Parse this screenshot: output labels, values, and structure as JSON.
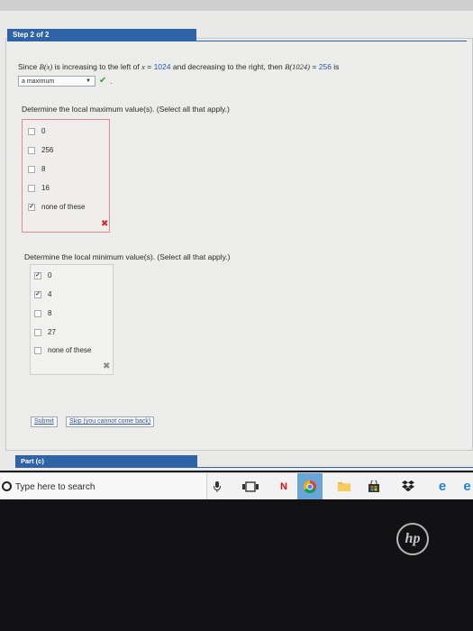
{
  "step": {
    "label": "Step 2 of 2"
  },
  "statement": {
    "since": "Since",
    "func": "B(x)",
    "middle": "is increasing to the left of",
    "xvar": "x",
    "eq": "=",
    "xval": "1024",
    "after": "and decreasing to the right, then",
    "func_at": "B(1024)",
    "eq2": "=",
    "value": "256",
    "is": "is",
    "period": "."
  },
  "dropdown": {
    "selected": "a maximum",
    "status_icon": "green-check"
  },
  "question_max": {
    "prompt": "Determine the local maximum value(s). (Select all that apply.)",
    "options": [
      {
        "label": "0",
        "checked": false
      },
      {
        "label": "256",
        "checked": false
      },
      {
        "label": "8",
        "checked": false
      },
      {
        "label": "16",
        "checked": false
      },
      {
        "label": "none of these",
        "checked": true
      }
    ],
    "result_icon": "red-x",
    "check_symbol": "✔",
    "x_symbol": "✖"
  },
  "question_min": {
    "prompt": "Determine the local minimum value(s). (Select all that apply.)",
    "options": [
      {
        "label": "0",
        "checked": true
      },
      {
        "label": "4",
        "checked": true
      },
      {
        "label": "8",
        "checked": false
      },
      {
        "label": "27",
        "checked": false
      },
      {
        "label": "none of these",
        "checked": false
      }
    ],
    "result_icon": "gray-x",
    "x_symbol": "✖"
  },
  "buttons": {
    "submit": "Submit",
    "skip": "Skip (you cannot come back)"
  },
  "part": {
    "label": "Part (c)"
  },
  "taskbar": {
    "search_placeholder": "Type here to search",
    "icons": [
      "microphone-icon",
      "task-view-icon",
      "netflix-icon",
      "chrome-icon",
      "file-explorer-icon",
      "store-icon",
      "dropbox-icon",
      "edge-icon",
      "edge-icon"
    ]
  },
  "brand": {
    "logo_text": "hp"
  },
  "colors": {
    "accent_blue": "#2f63a7",
    "correct_green": "#3c9b37",
    "wrong_red": "#d02b2b"
  }
}
